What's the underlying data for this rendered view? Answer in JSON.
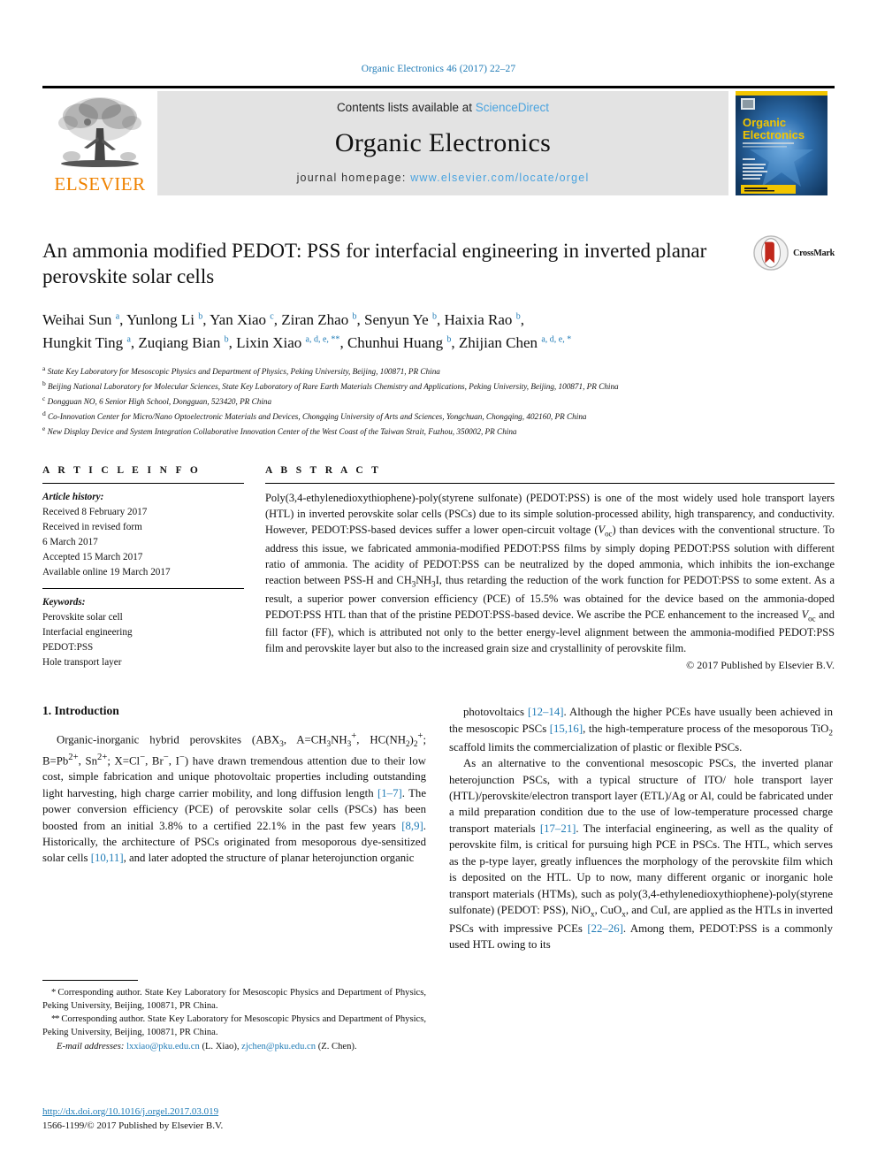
{
  "running_head": "Organic Electronics 46 (2017) 22–27",
  "masthead": {
    "publisher_name": "ELSEVIER",
    "contents_prefix": "Contents lists available at ",
    "contents_link": "ScienceDirect",
    "journal_name": "Organic Electronics",
    "homepage_prefix": "journal homepage: ",
    "homepage_url": "www.elsevier.com/locate/orgel",
    "cover_title_line1": "Organic",
    "cover_title_line2": "Electronics"
  },
  "article": {
    "title": "An ammonia modified PEDOT: PSS for interfacial engineering in inverted planar perovskite solar cells",
    "crossmark_label": "CrossMark",
    "authors_line1_html": "Weihai Sun <sup>a</sup>, Yunlong Li <sup>b</sup>, Yan Xiao <sup>c</sup>, Ziran Zhao <sup>b</sup>, Senyun Ye <sup>b</sup>, Haixia Rao <sup>b</sup>,",
    "authors_line2_html": "Hungkit Ting <sup>a</sup>, Zuqiang Bian <sup>b</sup>, Lixin Xiao <sup>a, d, e, **</sup>, Chunhui Huang <sup>b</sup>, Zhijian Chen <sup>a, d, e, *</sup>",
    "affiliations": [
      "<sup>a</sup> State Key Laboratory for Mesoscopic Physics and Department of Physics, Peking University, Beijing, 100871, PR China",
      "<sup>b</sup> Beijing National Laboratory for Molecular Sciences, State Key Laboratory of Rare Earth Materials Chemistry and Applications, Peking University, Beijing, 100871, PR China",
      "<sup>c</sup> Dongguan NO, 6 Senior High School, Dongguan, 523420, PR China",
      "<sup>d</sup> Co-Innovation Center for Micro/Nano Optoelectronic Materials and Devices, Chongqing University of Arts and Sciences, Yongchuan, Chongqing, 402160, PR China",
      "<sup>e</sup> New Display Device and System Integration Collaborative Innovation Center of the West Coast of the Taiwan Strait, Fuzhou, 350002, PR China"
    ]
  },
  "article_info": {
    "heading": "A R T I C L E  I N F O",
    "history_label": "Article history:",
    "history": [
      "Received 8 February 2017",
      "Received in revised form",
      "6 March 2017",
      "Accepted 15 March 2017",
      "Available online 19 March 2017"
    ],
    "keywords_label": "Keywords:",
    "keywords": [
      "Perovskite solar cell",
      "Interfacial engineering",
      "PEDOT:PSS",
      "Hole transport layer"
    ]
  },
  "abstract": {
    "heading": "A B S T R A C T",
    "body_html": "Poly(3,4-ethylenedioxythiophene)-poly(styrene sulfonate) (PEDOT:PSS) is one of the most widely used hole transport layers (HTL) in inverted perovskite solar cells (PSCs) due to its simple solution-processed ability, high transparency, and conductivity. However, PEDOT:PSS-based devices suffer a lower open-circuit voltage (<i>V</i><sub>oc</sub>) than devices with the conventional structure. To address this issue, we fabricated ammonia-modified PEDOT:PSS films by simply doping PEDOT:PSS solution with different ratio of ammonia. The acidity of PEDOT:PSS can be neutralized by the doped ammonia, which inhibits the ion-exchange reaction between PSS-H and CH<sub>3</sub>NH<sub>3</sub>I, thus retarding the reduction of the work function for PEDOT:PSS to some extent. As a result, a superior power conversion efficiency (PCE) of 15.5% was obtained for the device based on the ammonia-doped PEDOT:PSS HTL than that of the pristine PEDOT:PSS-based device. We ascribe the PCE enhancement to the increased <i>V</i><sub>oc</sub> and fill factor (FF), which is attributed not only to the better energy-level alignment between the ammonia-modified PEDOT:PSS film and perovskite layer but also to the increased grain size and crystallinity of perovskite film.",
    "copyright": "© 2017 Published by Elsevier B.V."
  },
  "introduction": {
    "heading": "1.  Introduction",
    "left_paragraph_html": "Organic-inorganic hybrid perovskites (ABX<sub>3</sub>, A&#61;CH<sub>3</sub>NH<sub>3</sub><sup>+</sup>, HC(NH<sub>2</sub>)<sub>2</sub><sup>+</sup>; B&#61;Pb<sup>2+</sup>, Sn<sup>2+</sup>; X&#61;Cl<sup>−</sup>, Br<sup>−</sup>, I<sup>−</sup>) have drawn tremendous attention due to their low cost, simple fabrication and unique photovoltaic properties including outstanding light harvesting, high charge carrier mobility, and long diffusion length <span class=\"ref\">[1–7]</span>. The power conversion efficiency (PCE) of perovskite solar cells (PSCs) has been boosted from an initial 3.8% to a certified 22.1% in the past few years <span class=\"ref\">[8,9]</span>. Historically, the architecture of PSCs originated from mesoporous dye-sensitized solar cells <span class=\"ref\">[10,11]</span>, and later adopted the structure of planar heterojunction organic",
    "right_paragraph1_html": "photovoltaics <span class=\"ref\">[12–14]</span>. Although the higher PCEs have usually been achieved in the mesoscopic PSCs <span class=\"ref\">[15,16]</span>, the high-temperature process of the mesoporous TiO<sub>2</sub> scaffold limits the commercialization of plastic or flexible PSCs.",
    "right_paragraph2_html": "As an alternative to the conventional mesoscopic PSCs, the inverted planar heterojunction PSCs, with a typical structure of ITO/ hole transport layer (HTL)/perovskite/electron transport layer (ETL)/Ag or Al, could be fabricated under a mild preparation condition due to the use of low-temperature processed charge transport materials <span class=\"ref\">[17–21]</span>. The interfacial engineering, as well as the quality of perovskite film, is critical for pursuing high PCE in PSCs. The HTL, which serves as the p-type layer, greatly influences the morphology of the perovskite film which is deposited on the HTL. Up to now, many different organic or inorganic hole transport materials (HTMs), such as poly(3,4-ethylenedioxythiophene)-poly(styrene sulfonate) (PEDOT: PSS), NiO<sub>x</sub>, CuO<sub>x</sub>, and CuI, are applied as the HTLs in inverted PSCs with impressive PCEs <span class=\"ref\">[22–26]</span>. Among them, PEDOT:PSS is a commonly used HTL owing to its"
  },
  "footnotes": {
    "note1_html": "<span class=\"star\">*</span> Corresponding author. State Key Laboratory for Mesoscopic Physics and Department of Physics, Peking University, Beijing, 100871, PR China.",
    "note2_html": "<span class=\"star\">**</span> Corresponding author. State Key Laboratory for Mesoscopic Physics and Department of Physics, Peking University, Beijing, 100871, PR China.",
    "email_label": "E-mail addresses:",
    "email1": "lxxiao@pku.edu.cn",
    "email1_person": "(L. Xiao),",
    "email2": "zjchen@pku.edu.cn",
    "email2_person": "(Z. Chen)."
  },
  "footer": {
    "doi": "http://dx.doi.org/10.1016/j.orgel.2017.03.019",
    "issn_line": "1566-1199/© 2017 Published by Elsevier B.V."
  },
  "colors": {
    "link_blue": "#1f7bb6",
    "light_blue": "#4aa3df",
    "elsevier_orange": "#ef8200",
    "banner_gray": "#e3e3e3"
  }
}
